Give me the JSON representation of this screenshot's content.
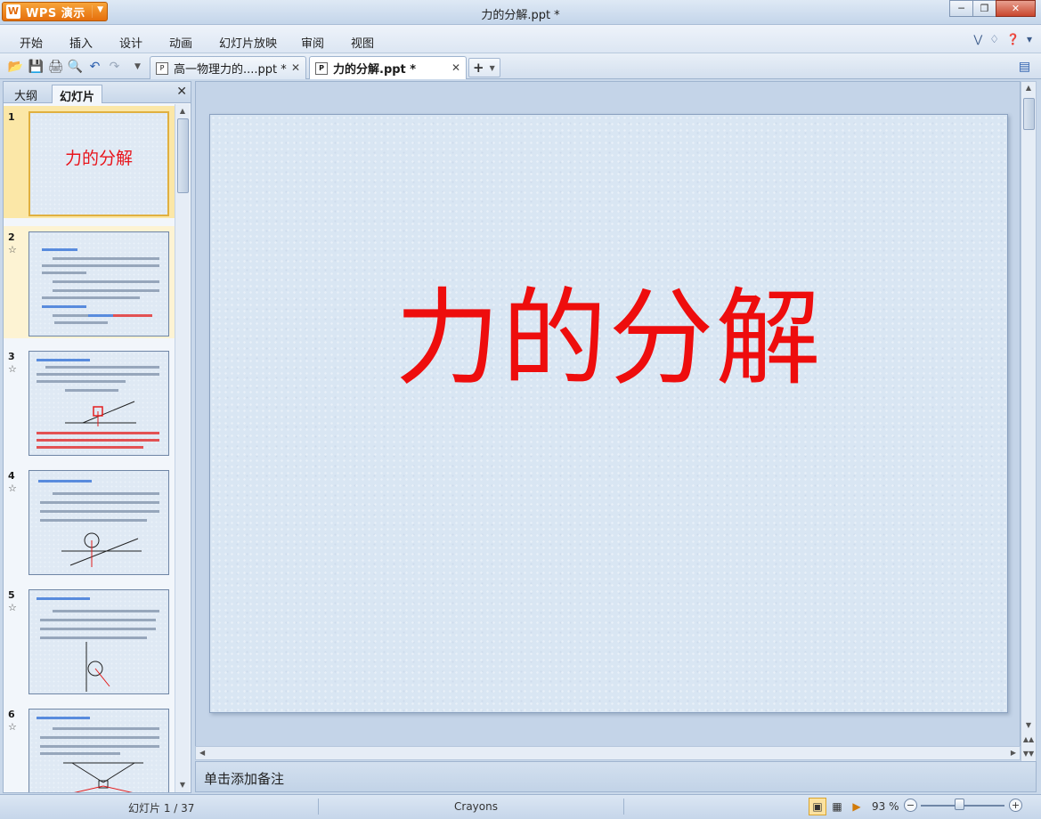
{
  "app": {
    "brand_label": "WPS 演示",
    "window_title": "力的分解.ppt *"
  },
  "menu": [
    "开始",
    "插入",
    "设计",
    "动画",
    "幻灯片放映",
    "审阅",
    "视图"
  ],
  "tabs": [
    {
      "label": "高一物理力的....ppt *",
      "active": false
    },
    {
      "label": "力的分解.ppt *",
      "active": true
    }
  ],
  "pane": {
    "tab_outline": "大纲",
    "tab_slides": "幻灯片"
  },
  "thumbnails": [
    {
      "num": "1",
      "title": "力的分解"
    },
    {
      "num": "2"
    },
    {
      "num": "3"
    },
    {
      "num": "4"
    },
    {
      "num": "5"
    },
    {
      "num": "6"
    }
  ],
  "slide": {
    "title": "力的分解",
    "title_color": "#ee0d0d"
  },
  "notes": {
    "placeholder": "单击添加备注"
  },
  "status": {
    "slide_indicator": "幻灯片 1 / 37",
    "theme": "Crayons",
    "zoom": "93 %"
  },
  "icons": {
    "open": "folder-open-icon",
    "save": "save-icon",
    "print": "print-icon",
    "preview": "print-preview-icon",
    "undo": "undo-icon",
    "redo": "redo-icon"
  }
}
